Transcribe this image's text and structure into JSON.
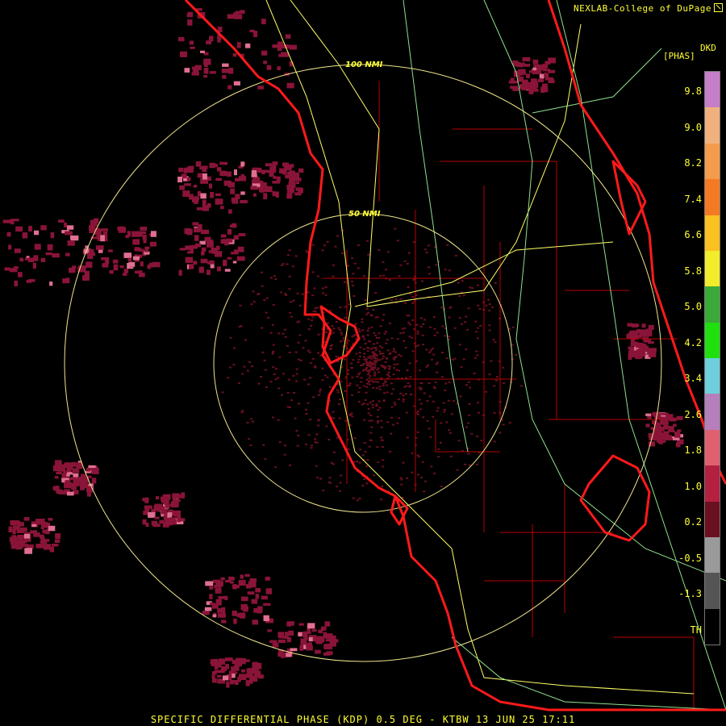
{
  "credit": "NEXLAB-College of DuPage",
  "product_code": "DKD",
  "units": "[PHAS]",
  "ring_labels": {
    "outer": "100 NMI",
    "inner": "50 NMI"
  },
  "legend": {
    "ticks": [
      "9.8",
      "9.0",
      "8.2",
      "7.4",
      "6.6",
      "5.8",
      "5.0",
      "4.2",
      "3.4",
      "2.6",
      "1.8",
      "1.0",
      "0.2",
      "-0.5",
      "-1.3",
      "TH"
    ],
    "colors": [
      "#c57fc8",
      "#f0b17e",
      "#f39c4b",
      "#f37a22",
      "#fbc120",
      "#f2ec2a",
      "#3ba83a",
      "#1fe00e",
      "#6ecfdc",
      "#b47fba",
      "#e06070",
      "#b32040",
      "#6b1020",
      "#9a9a9a",
      "#555555",
      "#000000"
    ]
  },
  "footer": "SPECIFIC DIFFERENTIAL PHASE (KDP) 0.5 DEG - KTBW 13 JUN 25 17:11",
  "colors": {
    "coast": "#ff1a1a",
    "county": "#c40000",
    "road_yellow": "#ffff66",
    "road_green": "#8fe08f",
    "ring": "#f0e68c",
    "echo": "#8a1438"
  }
}
